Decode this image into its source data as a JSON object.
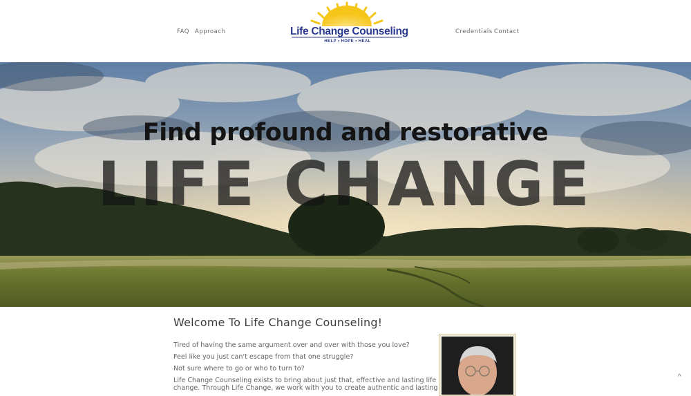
{
  "nav": {
    "left": [
      "FAQ",
      "Approach"
    ],
    "right": [
      "Credentials",
      "Contact"
    ]
  },
  "logo": {
    "name": "Life Change Counseling",
    "tagline": "HELP • HOPE • HEAL"
  },
  "hero": {
    "line1": "Find profound and restorative",
    "line2": "LIFE CHANGE"
  },
  "welcome": {
    "heading": "Welcome To Life Change Counseling!",
    "lines": [
      "Tired of having the same argument over and over with those you love?",
      "Feel like you just can't escape from that one struggle?",
      "Not sure where to go or who to turn to?",
      "Life Change Counseling exists to bring about just that, effective and lasting life",
      "change. Through Life Change, we work with you to create authentic and lasting"
    ]
  },
  "back_to_top": "^",
  "colors": {
    "brand_blue": "#2b3a8f",
    "sun_yellow": "#f5c518"
  }
}
